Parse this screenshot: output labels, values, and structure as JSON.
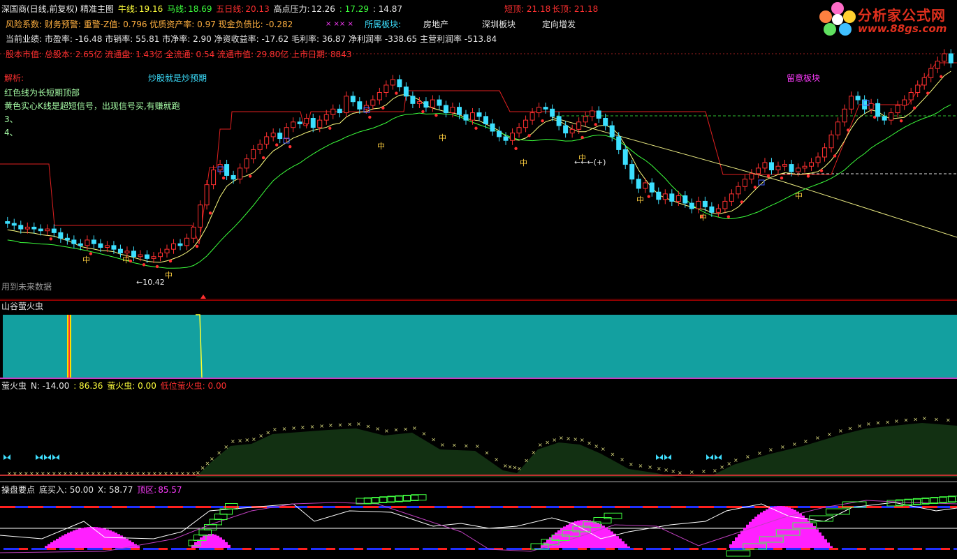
{
  "colors": {
    "background": "#000000",
    "up_candle": "#ff3030",
    "down_candle": "#3ce0ff",
    "ma_short": "#ffff80",
    "ma_long": "#3cff3c",
    "resistance": "#e02020",
    "valley_panel": "#13a0a0",
    "firefly_area": "#123012"
  },
  "header": {
    "title": "深国商(日线,前复权) 精准主图",
    "niu_label": "牛线:",
    "niu_value": "19.16",
    "ma_label": "马线:",
    "ma_value": "18.69",
    "wuri_label": "五日线:",
    "wuri_value": "20.13",
    "resist_label": "高点压力:",
    "resist_value": "12.26",
    "v1": ": 17.29",
    "v2": ": 14.87",
    "short_top": "短顶: 21.18",
    "long_top": "长顶: 21.18"
  },
  "info_lines": {
    "risk": "风险系数: 财务预警: 重警-Z值: 0.796 优质资产率: 0.97 现金负债比: -0.282",
    "perf": "当前业绩: 市盈率: -16.48 市销率: 55.81 市净率: 2.90 净资收益率: -17.62 毛利率: 36.87 净利润率 -338.65 主营利润率 -513.84",
    "cap": "股本市值: 总股本: 2.65亿 流通盘: 1.43亿 全流通: 0.54 流通市值: 29.80亿 上市日期: 8843"
  },
  "sector": {
    "label": "所属板块:",
    "items": [
      "房地产",
      "深圳板块",
      "定向增发"
    ],
    "marks": "× ×× ×"
  },
  "notes": {
    "title": "解析:",
    "line1": "红色线为长短期顶部",
    "line2": "黄色实心K线是超短信号，出现信号买,有赚就跑",
    "line3": "3、",
    "line4": "4、",
    "center": "炒股就是炒预期",
    "right": "留意板块",
    "future": "用到未来数据",
    "low_price": "←10.42",
    "arrow_label": "←←←(+)"
  },
  "logo": {
    "name": "分析家公式网",
    "url": "www.88gs.com"
  },
  "panel_valley": {
    "title": "山谷萤火虫"
  },
  "panel_firefly": {
    "title": "萤火虫",
    "n_label": "N: -14.00",
    "v_label": ": 86.36",
    "ff_label": "萤火虫: 0.00",
    "low_label": "低位萤火虫: 0.00"
  },
  "panel_op": {
    "title": "操盘要点",
    "buy_label": "底买入: 50.00",
    "x_label": "X: 58.77",
    "top_label": "顶区:",
    "top_value": "85.57"
  },
  "chart_data": {
    "type": "candlestick",
    "ylim": [
      9,
      23
    ],
    "closes": [
      12.4,
      12.3,
      12.1,
      12.2,
      12.1,
      12.0,
      12.1,
      11.9,
      11.6,
      11.5,
      11.3,
      11.2,
      11.5,
      11.3,
      11.1,
      11.2,
      11.0,
      10.8,
      10.9,
      10.6,
      10.7,
      10.5,
      10.6,
      10.8,
      11.0,
      11.3,
      11.2,
      11.6,
      12.2,
      13.4,
      14.5,
      15.3,
      15.6,
      15.0,
      14.8,
      15.4,
      15.9,
      16.4,
      16.7,
      17.1,
      17.3,
      17.0,
      17.6,
      17.9,
      17.8,
      18.1,
      17.6,
      18.0,
      18.3,
      18.6,
      18.4,
      19.3,
      19.0,
      18.6,
      18.8,
      19.1,
      19.5,
      19.9,
      20.2,
      19.8,
      19.3,
      18.9,
      19.0,
      18.7,
      19.1,
      18.8,
      18.4,
      18.7,
      18.3,
      18.0,
      18.4,
      18.2,
      17.8,
      17.4,
      17.1,
      16.9,
      17.3,
      17.6,
      18.0,
      18.4,
      18.7,
      18.6,
      18.2,
      17.7,
      17.3,
      17.5,
      17.9,
      18.2,
      18.5,
      18.1,
      17.7,
      17.1,
      16.4,
      15.6,
      14.8,
      14.3,
      14.6,
      14.1,
      13.7,
      14.0,
      13.6,
      13.9,
      13.5,
      13.2,
      13.6,
      13.3,
      13.0,
      13.2,
      13.6,
      14.0,
      14.4,
      14.8,
      15.1,
      15.4,
      15.7,
      15.3,
      15.5,
      15.6,
      15.2,
      15.4,
      15.5,
      15.7,
      16.0,
      16.5,
      17.2,
      17.9,
      18.6,
      19.3,
      19.1,
      18.6,
      18.9,
      18.2,
      18.0,
      18.4,
      18.8,
      19.1,
      19.5,
      19.9,
      20.3,
      20.8,
      21.2,
      21.6,
      21.1
    ],
    "ma_short_note": "yellow",
    "ma_long_note": "green"
  }
}
